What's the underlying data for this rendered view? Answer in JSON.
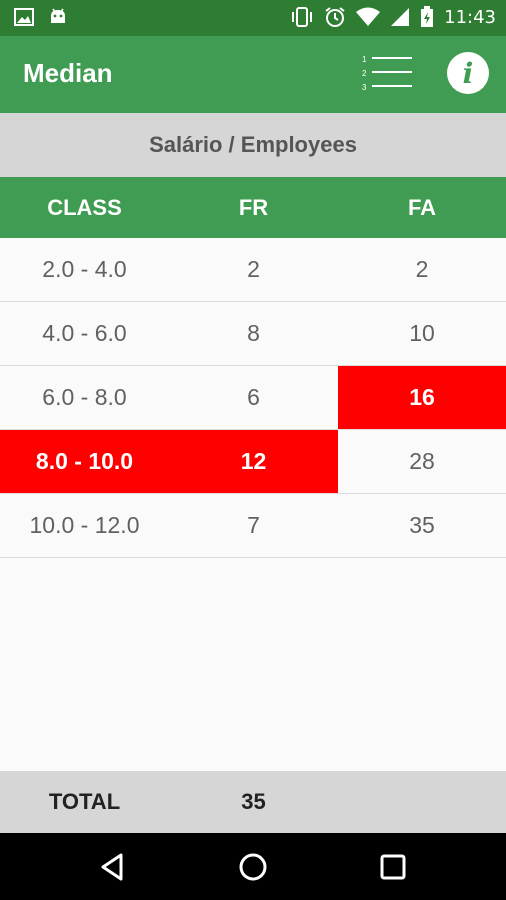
{
  "status_bar": {
    "time": "11:43",
    "left_icons": [
      "image-icon",
      "android-icon"
    ],
    "right_icons": [
      "vibrate-icon",
      "alarm-icon",
      "wifi-icon",
      "signal-icon",
      "battery-icon"
    ]
  },
  "app_bar": {
    "title": "Median",
    "list_icon": "numbered-list-icon",
    "info_icon": "info-icon"
  },
  "table": {
    "subtitle": "Salário / Employees",
    "headers": [
      "CLASS",
      "FR",
      "FA"
    ],
    "rows": [
      {
        "class": "2.0 - 4.0",
        "fr": "2",
        "fa": "2"
      },
      {
        "class": "4.0 - 6.0",
        "fr": "8",
        "fa": "10"
      },
      {
        "class": "6.0 - 8.0",
        "fr": "6",
        "fa": "16"
      },
      {
        "class": "8.0 - 10.0",
        "fr": "12",
        "fa": "28"
      },
      {
        "class": "10.0 - 12.0",
        "fr": "7",
        "fa": "35"
      }
    ]
  },
  "total": {
    "label": "TOTAL",
    "value": "35"
  },
  "nav_bar": {
    "icons": [
      "back-icon",
      "home-icon",
      "recents-icon"
    ]
  },
  "colors": {
    "status_bar": "#2e7d32",
    "primary": "#3f9c52",
    "highlight": "#ff0000",
    "subtitle_bg": "#d6d6d6"
  }
}
